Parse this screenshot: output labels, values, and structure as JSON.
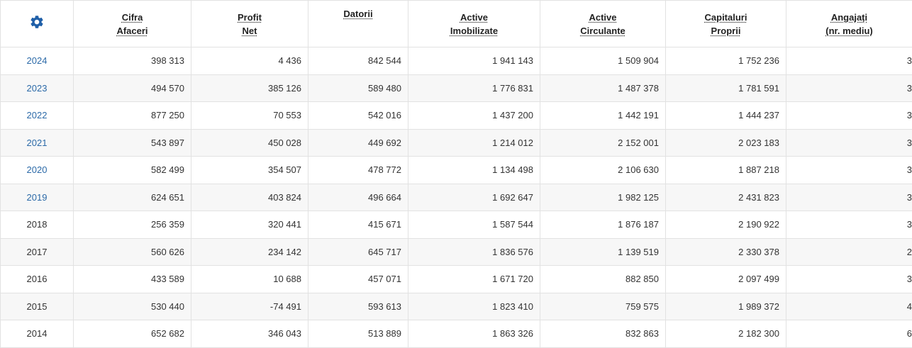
{
  "settings_icon": "gear-icon",
  "accent_color": "#2c6aa8",
  "headers": [
    {
      "line1": "Cifra",
      "line2": "Afaceri"
    },
    {
      "line1": "Profit",
      "line2": "Net"
    },
    {
      "line1": "Datorii",
      "line2": ""
    },
    {
      "line1": "Active",
      "line2": "Imobilizate"
    },
    {
      "line1": "Active",
      "line2": "Circulante"
    },
    {
      "line1": "Capitaluri",
      "line2": "Proprii"
    },
    {
      "line1": "Angajați",
      "line2": "(nr. mediu)"
    }
  ],
  "rows": [
    {
      "year": "2024",
      "link": true,
      "values": [
        "398 313",
        "4 436",
        "842 544",
        "1 941 143",
        "1 509 904",
        "1 752 236",
        "3"
      ]
    },
    {
      "year": "2023",
      "link": true,
      "values": [
        "494 570",
        "385 126",
        "589 480",
        "1 776 831",
        "1 487 378",
        "1 781 591",
        "3"
      ]
    },
    {
      "year": "2022",
      "link": true,
      "values": [
        "877 250",
        "70 553",
        "542 016",
        "1 437 200",
        "1 442 191",
        "1 444 237",
        "3"
      ]
    },
    {
      "year": "2021",
      "link": true,
      "values": [
        "543 897",
        "450 028",
        "449 692",
        "1 214 012",
        "2 152 001",
        "2 023 183",
        "3"
      ]
    },
    {
      "year": "2020",
      "link": true,
      "values": [
        "582 499",
        "354 507",
        "478 772",
        "1 134 498",
        "2 106 630",
        "1 887 218",
        "3"
      ]
    },
    {
      "year": "2019",
      "link": true,
      "values": [
        "624 651",
        "403 824",
        "496 664",
        "1 692 647",
        "1 982 125",
        "2 431 823",
        "3"
      ]
    },
    {
      "year": "2018",
      "link": false,
      "values": [
        "256 359",
        "320 441",
        "415 671",
        "1 587 544",
        "1 876 187",
        "2 190 922",
        "3"
      ]
    },
    {
      "year": "2017",
      "link": false,
      "values": [
        "560 626",
        "234 142",
        "645 717",
        "1 836 576",
        "1 139 519",
        "2 330 378",
        "2"
      ]
    },
    {
      "year": "2016",
      "link": false,
      "values": [
        "433 589",
        "10 688",
        "457 071",
        "1 671 720",
        "882 850",
        "2 097 499",
        "3"
      ]
    },
    {
      "year": "2015",
      "link": false,
      "values": [
        "530 440",
        "-74 491",
        "593 613",
        "1 823 410",
        "759 575",
        "1 989 372",
        "4"
      ]
    },
    {
      "year": "2014",
      "link": false,
      "values": [
        "652 682",
        "346 043",
        "513 889",
        "1 863 326",
        "832 863",
        "2 182 300",
        "6"
      ]
    }
  ]
}
